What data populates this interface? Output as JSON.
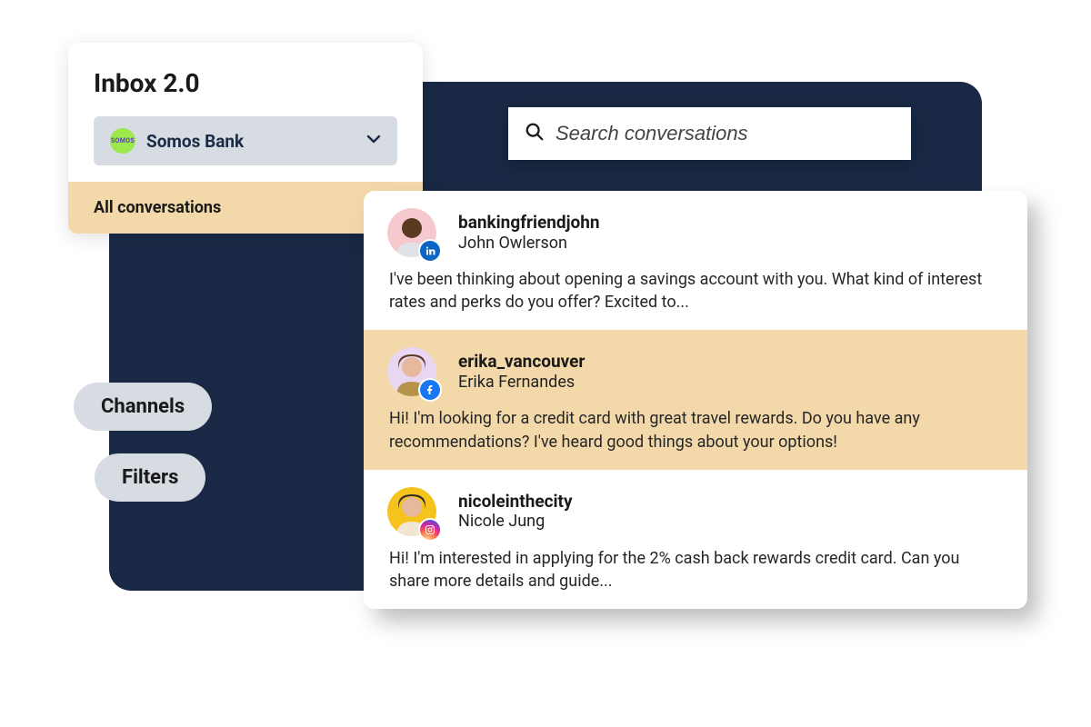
{
  "inbox": {
    "title": "Inbox 2.0",
    "org_logo_text": "SOMOS",
    "org_name": "Somos Bank",
    "all_conversations_label": "All conversations"
  },
  "search": {
    "placeholder": "Search conversations"
  },
  "pills": {
    "channels": "Channels",
    "filters": "Filters"
  },
  "conversations": [
    {
      "username": "bankingfriendjohn",
      "realname": "John Owlerson",
      "snippet": " I've been thinking about opening a savings account with you. What kind of interest rates and perks do you offer? Excited to...",
      "network": "linkedin",
      "highlighted": false,
      "avatar_bg": "#f6c9cf",
      "avatar_skin": "#5a3a22",
      "avatar_shirt": "#dfe3e8"
    },
    {
      "username": "erika_vancouver",
      "realname": "Erika Fernandes",
      "snippet": "Hi! I'm looking for a credit card with great travel rewards. Do you have any recommendations? I've heard good things about your options!",
      "network": "facebook",
      "highlighted": true,
      "avatar_bg": "#e9d6f2",
      "avatar_skin": "#e6b89c",
      "avatar_shirt": "#b8934a",
      "avatar_hair": "#5a3a22"
    },
    {
      "username": "nicoleinthecity",
      "realname": "Nicole Jung",
      "snippet": "Hi! I'm interested in applying for the 2% cash back rewards credit card. Can you share more details and guide...",
      "network": "instagram",
      "highlighted": false,
      "avatar_bg": "#f6c21c",
      "avatar_skin": "#e6b89c",
      "avatar_shirt": "#f0e6d2",
      "avatar_hair": "#2b2b2b"
    }
  ]
}
